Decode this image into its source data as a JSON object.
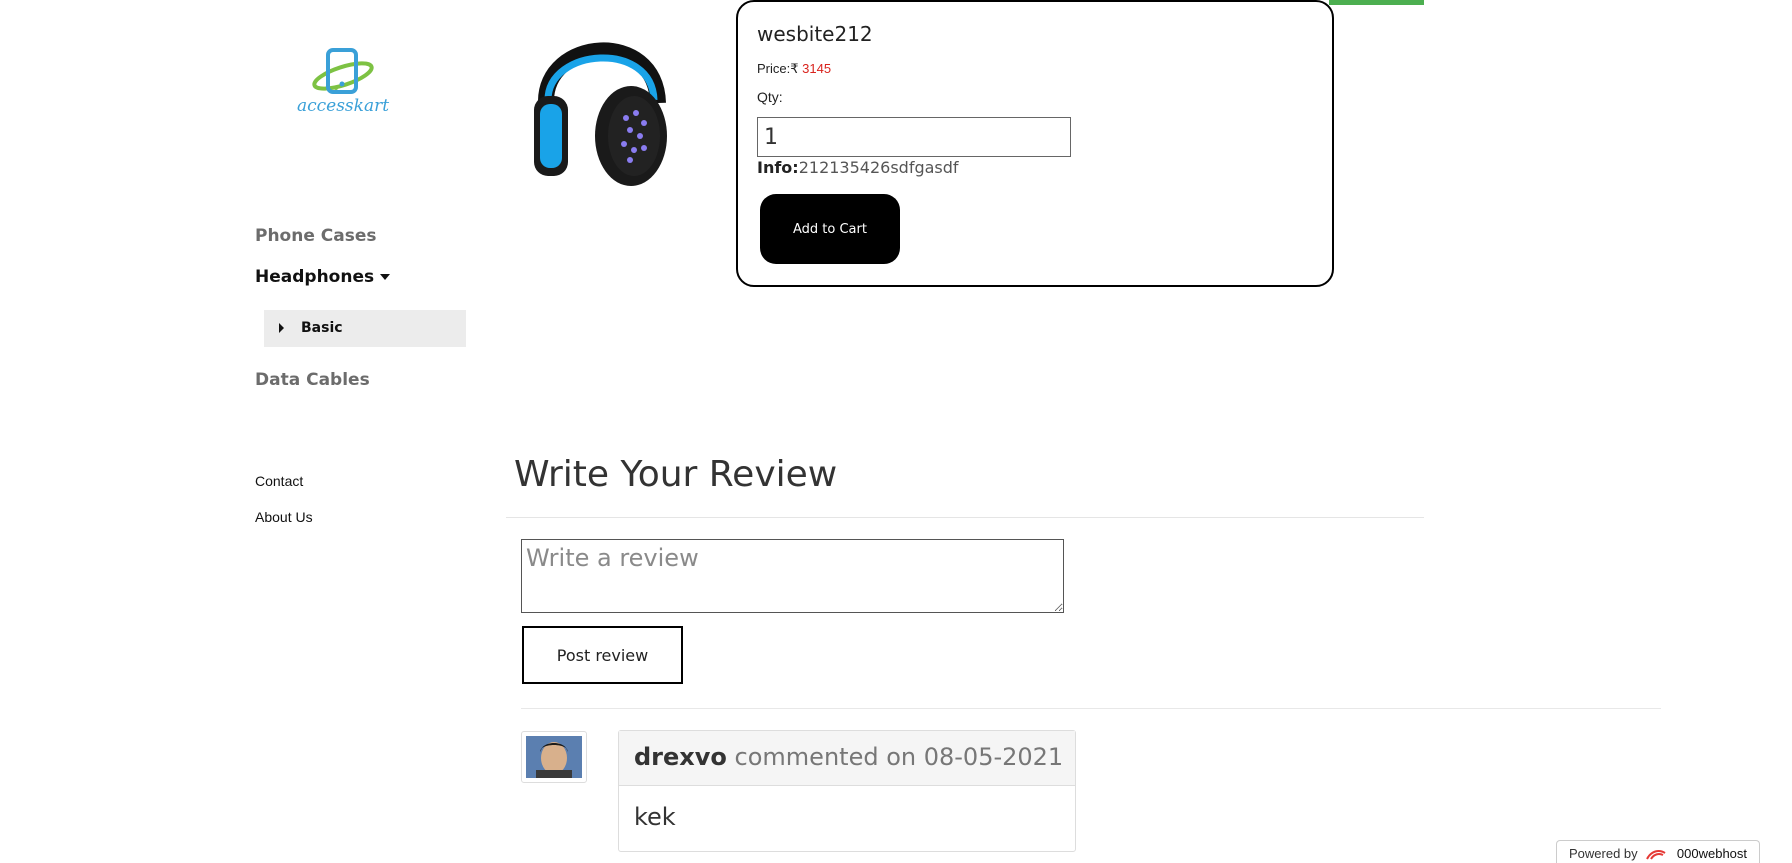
{
  "sidebar": {
    "logo_text": "accesskart",
    "categories": [
      {
        "label": "Phone Cases"
      },
      {
        "label": "Headphones"
      },
      {
        "label": "Data Cables"
      }
    ],
    "subcategory": {
      "label": "Basic"
    },
    "footer_links": [
      {
        "label": "Contact"
      },
      {
        "label": "About Us"
      }
    ]
  },
  "product": {
    "name": "wesbite212",
    "price_label": "Price:",
    "currency": "₹",
    "price_value": "3145",
    "qty_label": "Qty:",
    "qty_value": "1",
    "info_label": "Info:",
    "info_value": "212135426sdfgasdf",
    "add_to_cart_label": "Add to Cart"
  },
  "review": {
    "title": "Write Your Review",
    "placeholder": "Write a review",
    "post_label": "Post review",
    "comments": [
      {
        "author": "drexvo",
        "action": "commented on 08-05-2021",
        "text": "kek"
      }
    ]
  },
  "footer": {
    "powered_by": "Powered by",
    "host": "000webhost"
  },
  "colors": {
    "accent_green": "#4caf50",
    "price_red": "#d9231d",
    "logo_blue": "#3aa0d8",
    "logo_green": "#7dc243"
  }
}
